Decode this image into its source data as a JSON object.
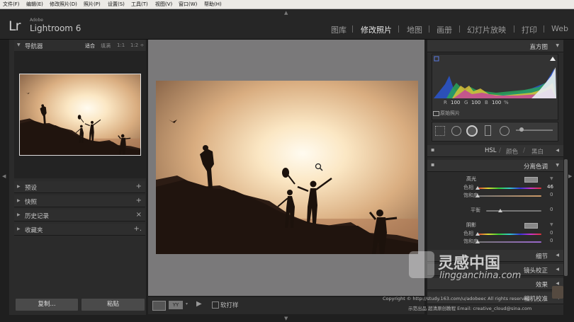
{
  "menu": [
    "文件(F)",
    "编辑(E)",
    "修改照片(D)",
    "照片(P)",
    "设置(S)",
    "工具(T)",
    "视图(V)",
    "窗口(W)",
    "帮助(H)"
  ],
  "brand": {
    "mark": "Lr",
    "adobe": "Adobe",
    "name": "Lightroom 6"
  },
  "modules": [
    "图库",
    "修改照片",
    "地图",
    "画册",
    "幻灯片放映",
    "打印",
    "Web"
  ],
  "active_module": "修改照片",
  "left": {
    "navigator_title": "导航器",
    "zoom_options": [
      "适合",
      "填满",
      "1:1",
      "1:2 ÷"
    ],
    "presets": "预设",
    "snapshots": "快照",
    "history": "历史记录",
    "collections": "收藏夹",
    "copy_btn": "复制...",
    "paste_btn": "粘贴"
  },
  "toolbar": {
    "soft_proof": "软打样"
  },
  "right": {
    "histogram_title": "直方图",
    "histo_readout": {
      "r_label": "R",
      "r": "100",
      "g_label": "G",
      "g": "100",
      "b_label": "B",
      "b": "100",
      "pct": "%"
    },
    "original_photo": "原始照片",
    "tabs": [
      "HSL",
      "颜色",
      "黑白"
    ],
    "split_toning_title": "分离色调",
    "highlights_label": "高光",
    "hue_label": "色相",
    "saturation_label": "饱和度",
    "hue_value": "46",
    "sat_value": "0",
    "balance_label": "平衡",
    "balance_value": "0",
    "shadows_label": "阴影",
    "shadow_hue_value": "0",
    "shadow_sat_value": "0",
    "detail_label": "细节",
    "lens_label": "镜头校正",
    "effects_label": "效果",
    "camera_label": "相机校准"
  },
  "watermark": {
    "brand_cn": "灵感中国",
    "domain": "lingganchina.com",
    "copyright": "Copyright © http://study.163.com/u/adobeec All rights reserved",
    "credits": "示范出品 超清原创教程 Email: creative_cloud@sina.com"
  },
  "colors": {
    "accent": "#e8e8e8",
    "panel": "#2b2b2b",
    "canvas": "#7a797a"
  }
}
